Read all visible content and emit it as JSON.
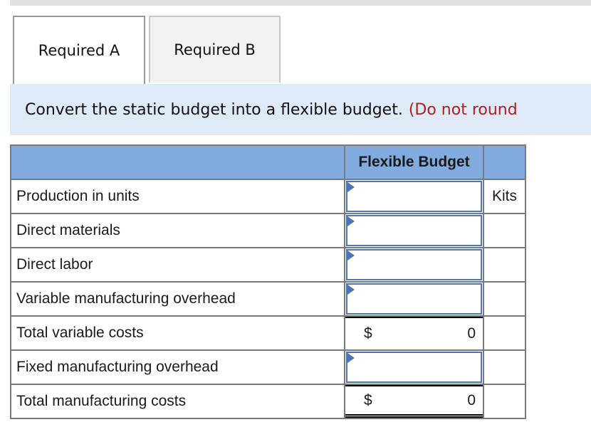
{
  "tabs": [
    {
      "label": "Required A",
      "active": true
    },
    {
      "label": "Required B",
      "active": false
    }
  ],
  "instruction": {
    "text": "Convert the static budget into a flexible budget.",
    "note": "(Do not round"
  },
  "table": {
    "header": {
      "label_col": "",
      "value_col": "Flexible Budget",
      "unit_col": ""
    },
    "rows": [
      {
        "label": "Production in units",
        "type": "input",
        "value": "",
        "unit": "Kits"
      },
      {
        "label": "Direct materials",
        "type": "input",
        "value": "",
        "unit": ""
      },
      {
        "label": "Direct labor",
        "type": "input",
        "value": "",
        "unit": ""
      },
      {
        "label": "Variable manufacturing overhead",
        "type": "input",
        "value": "",
        "unit": ""
      },
      {
        "label": "Total variable costs",
        "type": "calc",
        "currency": "$",
        "value": "0",
        "unit": ""
      },
      {
        "label": "Fixed manufacturing overhead",
        "type": "input",
        "value": "",
        "unit": ""
      },
      {
        "label": "Total manufacturing costs",
        "type": "calc",
        "currency": "$",
        "value": "0",
        "unit": ""
      }
    ]
  },
  "colors": {
    "header_bg": "#82abdf",
    "instruction_bg": "#deeaf7",
    "input_border": "#4a78b5",
    "note_red": "#b01e1e"
  }
}
